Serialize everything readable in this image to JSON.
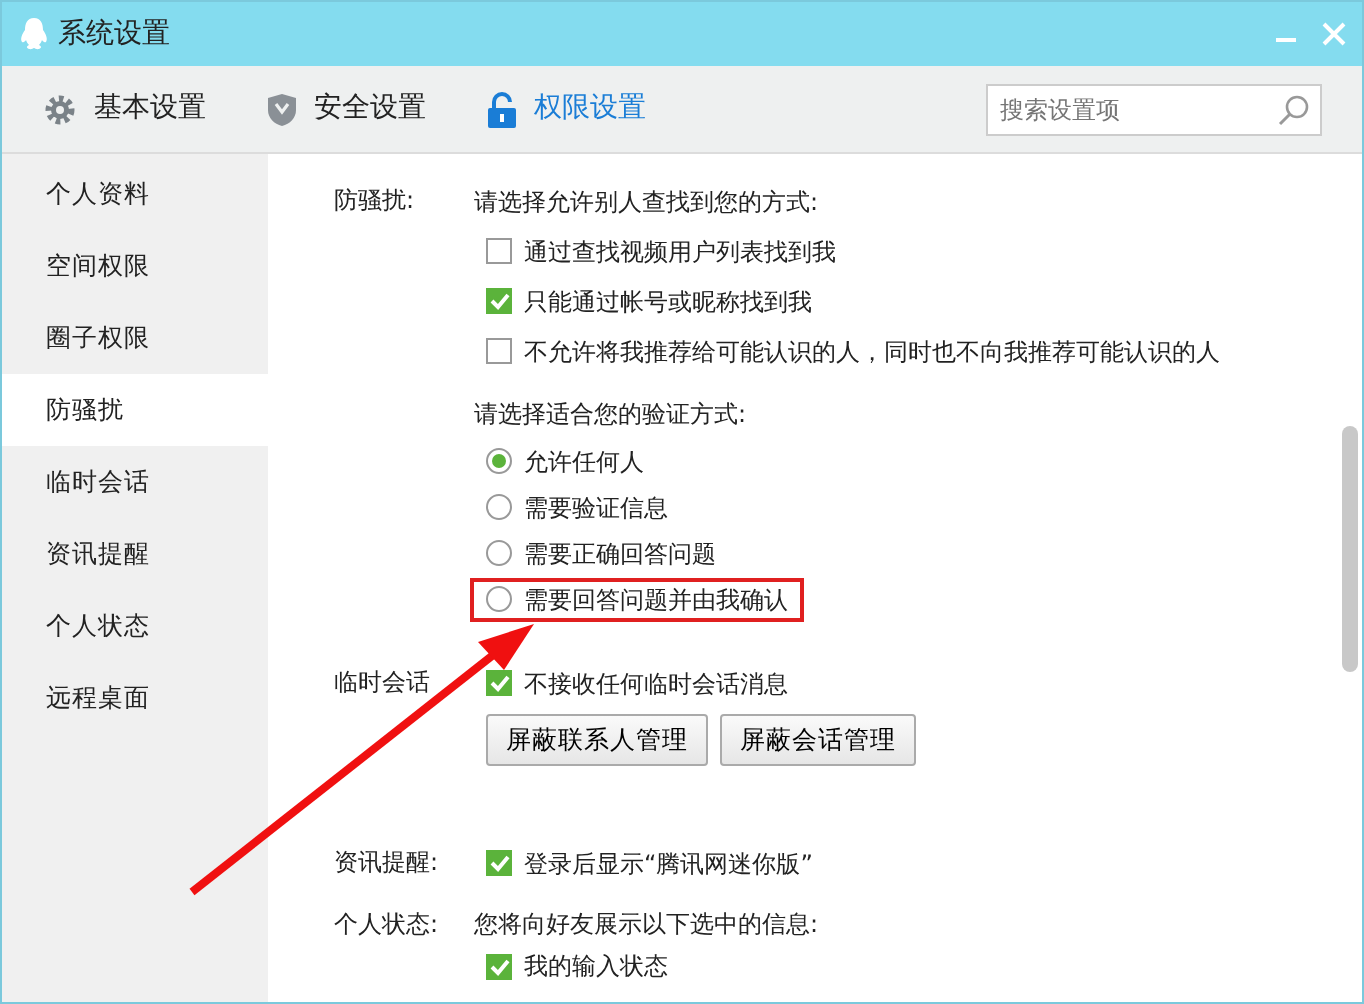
{
  "window": {
    "title": "系统设置"
  },
  "toolbar": {
    "tabs": [
      {
        "label": "基本设置",
        "selected": false
      },
      {
        "label": "安全设置",
        "selected": false
      },
      {
        "label": "权限设置",
        "selected": true
      }
    ],
    "search": {
      "placeholder": "搜索设置项"
    }
  },
  "sidebar": {
    "items": [
      {
        "label": "个人资料",
        "selected": false
      },
      {
        "label": "空间权限",
        "selected": false
      },
      {
        "label": "圈子权限",
        "selected": false
      },
      {
        "label": "防骚扰",
        "selected": true
      },
      {
        "label": "临时会话",
        "selected": false
      },
      {
        "label": "资讯提醒",
        "selected": false
      },
      {
        "label": "个人状态",
        "selected": false
      },
      {
        "label": "远程桌面",
        "selected": false
      }
    ]
  },
  "sections": [
    {
      "label": "防骚扰:",
      "groups": [
        {
          "prompt": "请选择允许别人查找到您的方式:",
          "options": [
            {
              "kind": "checkbox",
              "text": "通过查找视频用户列表找到我",
              "checked": false,
              "highlighted": false
            },
            {
              "kind": "checkbox",
              "text": "只能通过帐号或昵称找到我",
              "checked": true,
              "highlighted": false
            },
            {
              "kind": "checkbox",
              "text": "不允许将我推荐给可能认识的人，同时也不向我推荐可能认识的人",
              "checked": false,
              "highlighted": false
            }
          ]
        },
        {
          "prompt": "请选择适合您的验证方式:",
          "options": [
            {
              "kind": "radio",
              "text": "允许任何人",
              "selected": true,
              "highlighted": false
            },
            {
              "kind": "radio",
              "text": "需要验证信息",
              "selected": false,
              "highlighted": false
            },
            {
              "kind": "radio",
              "text": "需要正确回答问题",
              "selected": false,
              "highlighted": false
            },
            {
              "kind": "radio",
              "text": "需要回答问题并由我确认",
              "selected": false,
              "highlighted": true
            }
          ]
        }
      ]
    },
    {
      "label": "临时会话",
      "groups": [
        {
          "options": [
            {
              "kind": "checkbox",
              "text": "不接收任何临时会话消息",
              "checked": true,
              "highlighted": false
            }
          ]
        }
      ],
      "buttons": [
        "屏蔽联系人管理",
        "屏蔽会话管理"
      ]
    },
    {
      "label": "资讯提醒:",
      "groups": [
        {
          "options": [
            {
              "kind": "checkbox",
              "text": "登录后显示“腾讯网迷你版”",
              "checked": true,
              "highlighted": false
            }
          ]
        }
      ]
    },
    {
      "label": "个人状态:",
      "groups": [
        {
          "prompt": "您将向好友展示以下选中的信息:",
          "options": [
            {
              "kind": "checkbox",
              "text": "我的输入状态",
              "checked": true,
              "highlighted": false
            }
          ]
        }
      ]
    }
  ]
}
